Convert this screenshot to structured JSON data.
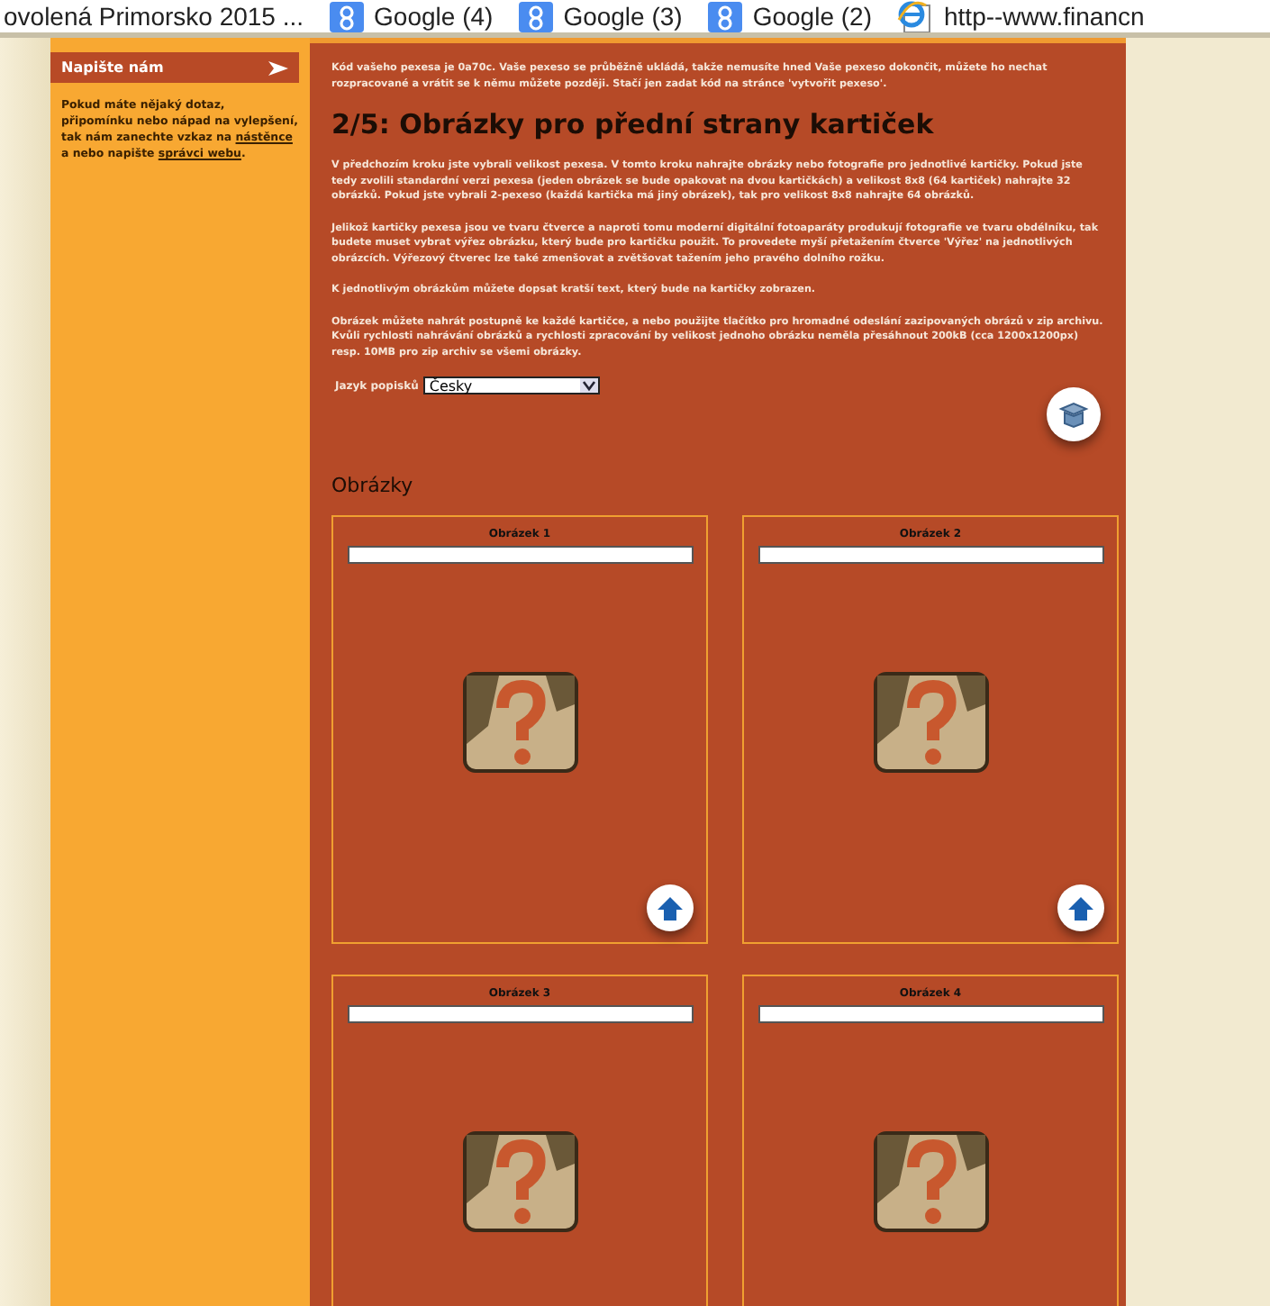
{
  "bookmarks": [
    {
      "label": "ovolená Primorsko 2015 ...",
      "kind": "plain"
    },
    {
      "label": "Google (4)",
      "kind": "google"
    },
    {
      "label": "Google (3)",
      "kind": "google"
    },
    {
      "label": "Google (2)",
      "kind": "google"
    },
    {
      "label": "http--www.financn",
      "kind": "ie"
    }
  ],
  "sidebar": {
    "title": "Napište nám",
    "text": "Pokud máte nějaký dotaz, připomínku nebo nápad na vylepšení, tak nám zanechte vzkaz na",
    "link_1": "nástěnce",
    "text_2": "a nebo napište",
    "link_2": "správci webu",
    "text_3": "."
  },
  "main": {
    "intro": "Kód vašeho pexesa je **0a70c**. Vaše pexeso se průběžně ukládá, takže nemusíte hned Vaše pexeso dokončit, můžete ho nechat rozpracované a vrátit se k němu můžete později. Stačí jen zadat kód na stránce 'vytvořit pexeso'.",
    "heading": "2/5: Obrázky pro přední strany kartiček",
    "paragraphs": [
      "V předchozím kroku jste vybrali velikost pexesa. V tomto kroku nahrajte obrázky nebo fotografie pro jednotlivé kartičky. Pokud jste tedy zvolili standardní verzi pexesa (jeden obrázek se bude opakovat na dvou kartičkách) a velikost 8x8 (64 kartiček) nahrajte 32 obrázků. Pokud jste vybrali 2-pexeso (každá kartička má jiný obrázek), tak pro velikost 8x8 nahrajte 64 obrázků.",
      "Jelikož kartičky pexesa jsou ve tvaru čtverce a naproti tomu moderní digitální fotoaparáty produkují fotografie ve tvaru obdélníku, tak budete muset vybrat výřez obrázku, který bude pro kartičku použit. To provedete myší přetažením čtverce 'Výřez' na jednotlivých obrázcích. Výřezový čtverec lze také zmenšovat a zvětšovat tažením jeho pravého dolního rožku.",
      "K jednotlivým obrázkům můžete dopsat kratší text, který bude na kartičky zobrazen.",
      "Obrázek můžete nahrát postupně ke každé kartičce, a nebo použijte tlačítko pro hromadné odeslání zazipovaných obrázů v zip archivu. Kvůli rychlosti nahrávání obrázků a rychlosti zpracování by velikost jednoho obrázku neměla přesáhnout 200kB (cca 1200x1200px) resp. 10MB pro zip archiv se všemi obrázky."
    ],
    "language": {
      "label": "Jazyk popisků",
      "value": "Česky"
    },
    "section_title": "Obrázky",
    "cards": [
      {
        "label": "Obrázek 1"
      },
      {
        "label": "Obrázek 2"
      },
      {
        "label": "Obrázek 3"
      },
      {
        "label": "Obrázek 4"
      }
    ]
  }
}
